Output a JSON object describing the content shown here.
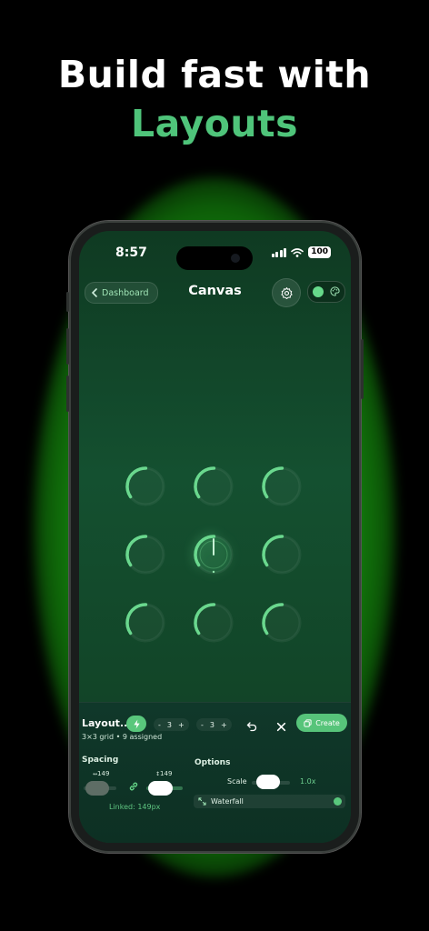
{
  "headline": {
    "line1": "Build fast with",
    "line2": "Layouts"
  },
  "colors": {
    "accent": "#59c77c",
    "background": "#000000",
    "glow": "#22c61a",
    "screen_bg": "#124528"
  },
  "status_bar": {
    "time": "8:57",
    "battery": "100",
    "icons": [
      "signal-icon",
      "wifi-icon",
      "battery-icon"
    ]
  },
  "nav": {
    "back_label": "Dashboard",
    "title": "Canvas",
    "icons": [
      "chevron-left-icon",
      "gear-icon",
      "palette-icon"
    ]
  },
  "grid": {
    "rows": 3,
    "cols": 3,
    "selected_index": 4,
    "knob_level": 0.35
  },
  "panel": {
    "title": "Layout...",
    "subtitle": "3×3 grid • 9 assigned",
    "stepper_rows": {
      "minus": "-",
      "value": "3",
      "plus": "+"
    },
    "stepper_cols": {
      "minus": "-",
      "value": "3",
      "plus": "+"
    },
    "create_label": "Create",
    "spacing": {
      "label": "Spacing",
      "h_icon": "↔",
      "h_value": "149",
      "v_icon": "↕",
      "v_value": "149",
      "linked_text": "Linked: 149px"
    },
    "options": {
      "label": "Options",
      "scale_label": "Scale",
      "scale_value": "1.0x",
      "waterfall_label": "Waterfall",
      "waterfall_enabled": true
    }
  }
}
